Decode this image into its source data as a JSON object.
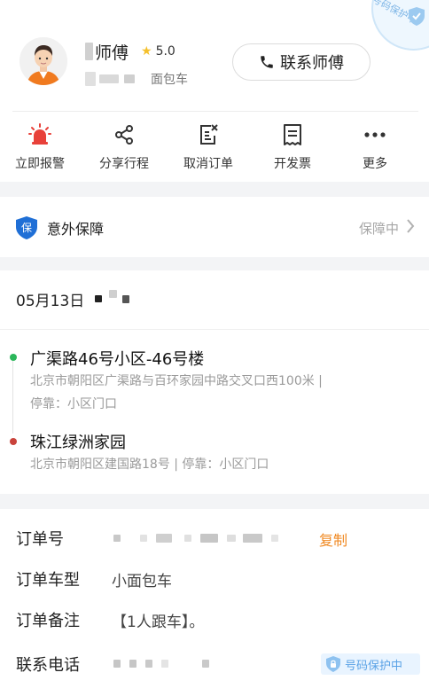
{
  "driver": {
    "name_suffix": "师傅",
    "rating": "5.0",
    "car_type": "面包车",
    "contact_label": "联系师傅",
    "corner_badge": "号码保护中"
  },
  "actions": [
    {
      "label": "立即报警",
      "icon": "alarm-icon"
    },
    {
      "label": "分享行程",
      "icon": "share-icon"
    },
    {
      "label": "取消订单",
      "icon": "cancel-order-icon"
    },
    {
      "label": "开发票",
      "icon": "invoice-icon"
    },
    {
      "label": "更多",
      "icon": "more-icon"
    }
  ],
  "insurance": {
    "badge": "保",
    "title": "意外保障",
    "status": "保障中"
  },
  "trip": {
    "date": "05月13日",
    "origin": {
      "name": "广渠路46号小区-46号楼",
      "address": "北京市朝阳区广渠路与百环家园中路交叉口西100米 |",
      "stop": "停靠：小区门口"
    },
    "destination": {
      "name": "珠江绿洲家园",
      "address": "北京市朝阳区建国路18号 | 停靠：小区门口"
    }
  },
  "order": {
    "order_no_label": "订单号",
    "copy_label": "复制",
    "car_model_label": "订单车型",
    "car_model_value": "小面包车",
    "remark_label": "订单备注",
    "remark_value": "【1人跟车】。",
    "phone_label": "联系电话",
    "phone_protect": "号码保护中"
  },
  "colors": {
    "accent_orange": "#f08a24",
    "alarm_red": "#e8413a",
    "star_yellow": "#f5c02b",
    "origin_green": "#2bb65a",
    "destination_red": "#c9433b",
    "protect_blue": "#5aa2e6"
  }
}
